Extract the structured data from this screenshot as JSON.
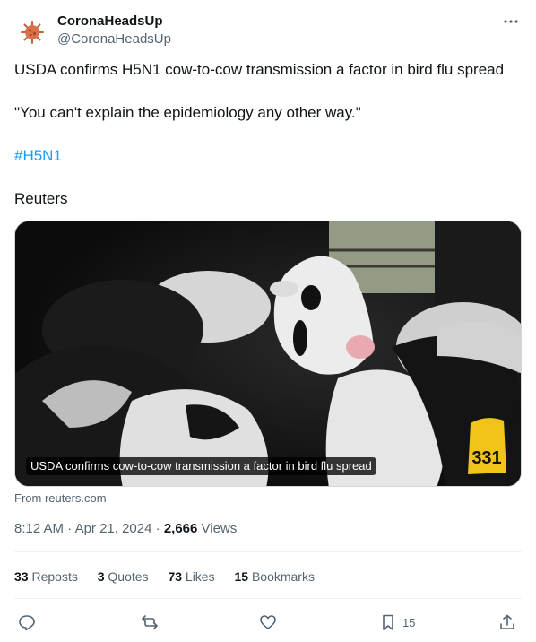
{
  "author": {
    "display_name": "CoronaHeadsUp",
    "handle": "@CoronaHeadsUp",
    "avatar_icon": "virus-icon"
  },
  "tweet": {
    "line1": "USDA confirms H5N1 cow-to-cow transmission a factor in bird flu spread",
    "line2": "\"You can't explain the epidemiology any other way.\"",
    "hashtag": "#H5N1",
    "line4": "Reuters"
  },
  "card": {
    "caption": "USDA confirms cow-to-cow transmission a factor in bird flu spread",
    "source": "From reuters.com",
    "ear_tag": "331"
  },
  "meta": {
    "time": "8:12 AM",
    "date": "Apr 21, 2024",
    "separator": " · ",
    "views_count": "2,666",
    "views_label": "Views"
  },
  "stats": {
    "reposts_count": "33",
    "reposts_label": "Reposts",
    "quotes_count": "3",
    "quotes_label": "Quotes",
    "likes_count": "73",
    "likes_label": "Likes",
    "bookmarks_count": "15",
    "bookmarks_label": "Bookmarks"
  },
  "actions": {
    "bookmark_count": "15"
  },
  "colors": {
    "link": "#1d9bf0",
    "secondary_text": "#536471",
    "primary_text": "#0f1419"
  }
}
